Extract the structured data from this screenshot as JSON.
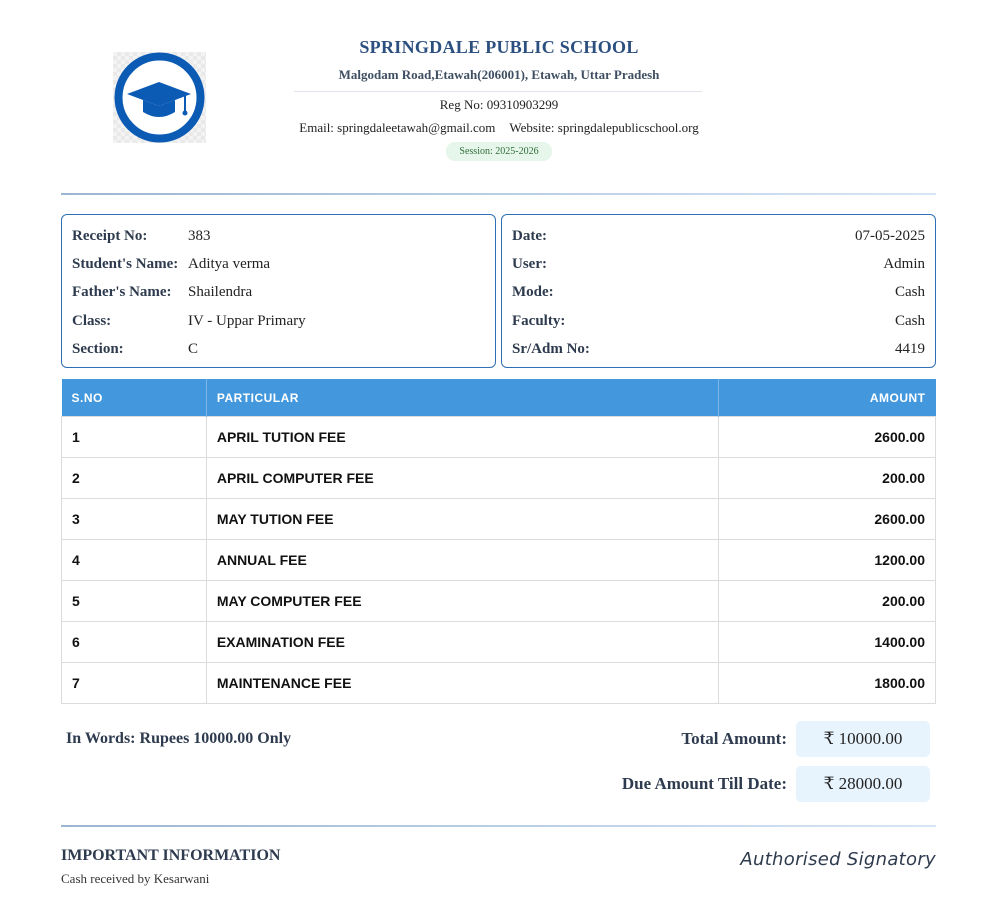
{
  "school": {
    "name": "SPRINGDALE PUBLIC SCHOOL",
    "address": "Malgodam Road,Etawah(206001), Etawah, Uttar Pradesh",
    "reg_no": "Reg No: 09310903299",
    "email": "Email: springdaleetawah@gmail.com",
    "website": "Website: springdalepublicschool.org",
    "session": "Session: 2025-2026",
    "logo_icon": "graduation-cap-icon"
  },
  "receipt_left": {
    "receipt_no": {
      "label": "Receipt No:",
      "value": "383"
    },
    "student_name": {
      "label": "Student's Name:",
      "value": "Aditya verma"
    },
    "father_name": {
      "label": "Father's Name:",
      "value": "Shailendra"
    },
    "class": {
      "label": "Class:",
      "value": "IV - Uppar Primary"
    },
    "section": {
      "label": "Section:",
      "value": "C"
    }
  },
  "receipt_right": {
    "date": {
      "label": "Date:",
      "value": "07-05-2025"
    },
    "user": {
      "label": "User:",
      "value": "Admin"
    },
    "mode": {
      "label": "Mode:",
      "value": "Cash"
    },
    "faculty": {
      "label": "Faculty:",
      "value": "Cash"
    },
    "sr_adm_no": {
      "label": "Sr/Adm No:",
      "value": "4419"
    }
  },
  "table": {
    "headers": {
      "sno": "S.NO",
      "particular": "PARTICULAR",
      "amount": "AMOUNT"
    },
    "rows": [
      {
        "sno": "1",
        "particular": "APRIL TUTION FEE",
        "amount": "2600.00"
      },
      {
        "sno": "2",
        "particular": "APRIL COMPUTER FEE",
        "amount": "200.00"
      },
      {
        "sno": "3",
        "particular": "MAY TUTION FEE",
        "amount": "2600.00"
      },
      {
        "sno": "4",
        "particular": "ANNUAL FEE",
        "amount": "1200.00"
      },
      {
        "sno": "5",
        "particular": "MAY COMPUTER FEE",
        "amount": "200.00"
      },
      {
        "sno": "6",
        "particular": "EXAMINATION FEE",
        "amount": "1400.00"
      },
      {
        "sno": "7",
        "particular": "MAINTENANCE FEE",
        "amount": "1800.00"
      }
    ]
  },
  "totals": {
    "in_words": "In Words: Rupees 10000.00 Only",
    "total_label": "Total Amount:",
    "total_value": "₹ 10000.00",
    "due_label": "Due Amount Till Date:",
    "due_value": "₹ 28000.00"
  },
  "footer": {
    "important_title": "IMPORTANT INFORMATION",
    "important_text": "Cash received by Kesarwani",
    "signatory": "Authorised Signatory"
  },
  "colors": {
    "primary": "#2b4f7e",
    "table_header": "#4398dd",
    "logo_blue": "#0b5bb5",
    "session_badge": "#e7f6ea",
    "total_box": "#e8f4fd"
  }
}
